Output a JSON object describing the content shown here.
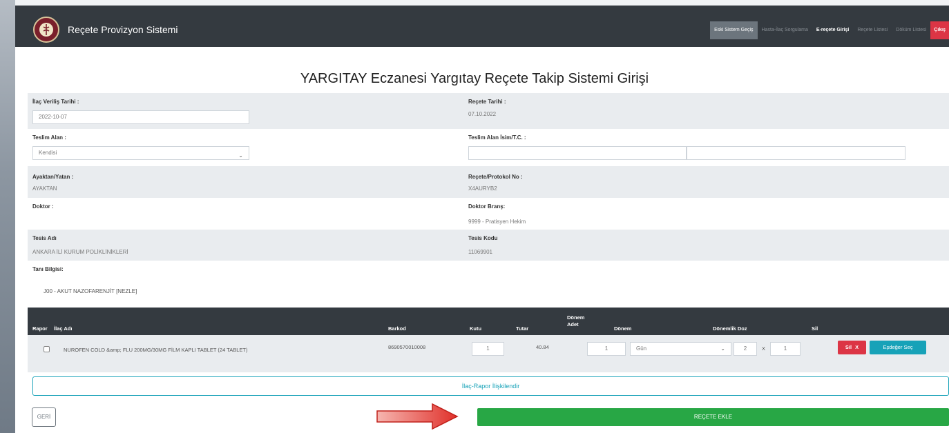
{
  "header": {
    "brand": "Reçete Provizyon Sistemi",
    "nav": [
      "Eski Sistem Geçiş",
      "Hasta-İlaç Sorgulama",
      "E-reçete Girişi",
      "Reçete Listesi",
      "Döküm Listesi",
      "Çıkış"
    ]
  },
  "page_title": "YARGITAY Eczanesi Yargıtay Reçete Takip Sistemi Girişi",
  "form": {
    "ilac_verilis_tarihi_label": "İlaç Veriliş Tarihi :",
    "ilac_verilis_tarihi_value": "2022-10-07",
    "recete_tarihi_label": "Reçete Tarihi :",
    "recete_tarihi_value": "07.10.2022",
    "teslim_alan_label": "Teslim Alan :",
    "teslim_alan_value": "Kendisi",
    "teslim_alan_isim_label": "Teslim Alan İsim/T.C. :",
    "ayaktan_label": "Ayaktan/Yatan :",
    "ayaktan_value": "AYAKTAN",
    "protokol_label": "Reçete/Protokol No :",
    "protokol_value": "X4AURYB2",
    "doktor_label": "Doktor :",
    "doktor_brans_label": "Doktor Branş:",
    "doktor_brans_value": "9999 - Pratisyen Hekim",
    "tesis_adi_label": "Tesis Adı",
    "tesis_adi_value": "ANKARA İLİ KURUM POLİKLİNİKLERİ",
    "tesis_kodu_label": "Tesis Kodu",
    "tesis_kodu_value": "11069901",
    "tani_label": "Tanı Bilgisi:",
    "tani_value": "J00 - AKUT NAZOFARENJİT [NEZLE]"
  },
  "table": {
    "headers": {
      "rapor": "Rapor",
      "ilac_adi": "İlaç Adı",
      "barkod": "Barkod",
      "kutu": "Kutu",
      "tutar": "Tutar",
      "donem_adet": "Dönem Adet",
      "donem": "Dönem",
      "donemlik_doz": "Dönemlik Doz",
      "sil": "Sil"
    },
    "row": {
      "ilac_adi": "NUROFEN COLD &amp; FLU 200MG/30MG FİLM KAPLI TABLET (24 TABLET)",
      "barkod": "8690570010008",
      "kutu": "1",
      "tutar": "40.84",
      "donem_adet": "1",
      "donem": "Gün",
      "doz_a": "2",
      "doz_x": "X",
      "doz_b": "1",
      "sil_label": "Sil",
      "sil_x": "X",
      "esdeger_label": "Eşdeğer Seç"
    }
  },
  "buttons": {
    "iliskilendir": "İlaç-Rapor İlişkilendir",
    "geri": "GERİ",
    "ekle": "REÇETE EKLE"
  },
  "colors": {
    "topbar": "#343a40",
    "danger": "#dc3545",
    "info": "#17a2b8",
    "success": "#28a745",
    "arrow": "#e0302a"
  }
}
